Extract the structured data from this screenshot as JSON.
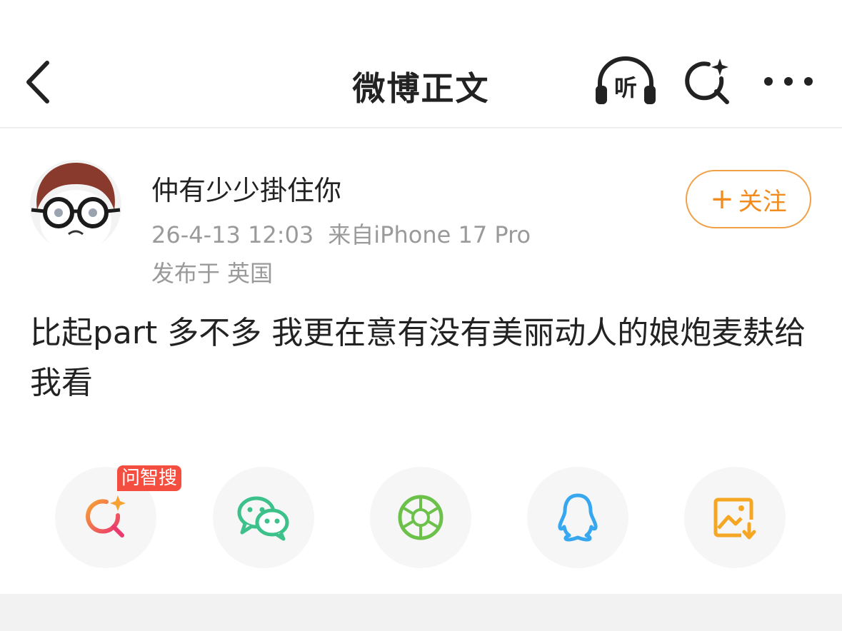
{
  "header": {
    "title": "微博正文",
    "listen_label": "听",
    "icons": {
      "back": "chevron-left-icon",
      "listen": "headphones-icon",
      "search": "sparkle-search-icon",
      "more": "more-dots-icon"
    }
  },
  "author": {
    "name": "仲有少少掛住你",
    "avatar": "avatar-image",
    "follow_plus": "+",
    "follow_label": "关注",
    "follow_color": "#f28c1e"
  },
  "post": {
    "date": "26-4-13 12:03",
    "source": "来自iPhone 17 Pro",
    "location_prefix": "发布于",
    "location": "英国",
    "text": "比起part 多不多 我更在意有没有美丽动人的娘炮麦麸给我看"
  },
  "share": {
    "badge": "问智搜",
    "items": [
      {
        "name": "wenzhisou",
        "icon": "sparkle-search-icon",
        "color": "#ef4b5a"
      },
      {
        "name": "wechat",
        "icon": "wechat-icon",
        "color": "#3cc18b"
      },
      {
        "name": "moments",
        "icon": "moments-aperture-icon",
        "color": "#6cc14a"
      },
      {
        "name": "qq",
        "icon": "qq-penguin-icon",
        "color": "#37a8f0"
      },
      {
        "name": "save-image",
        "icon": "image-download-icon",
        "color": "#f5a623"
      }
    ]
  }
}
